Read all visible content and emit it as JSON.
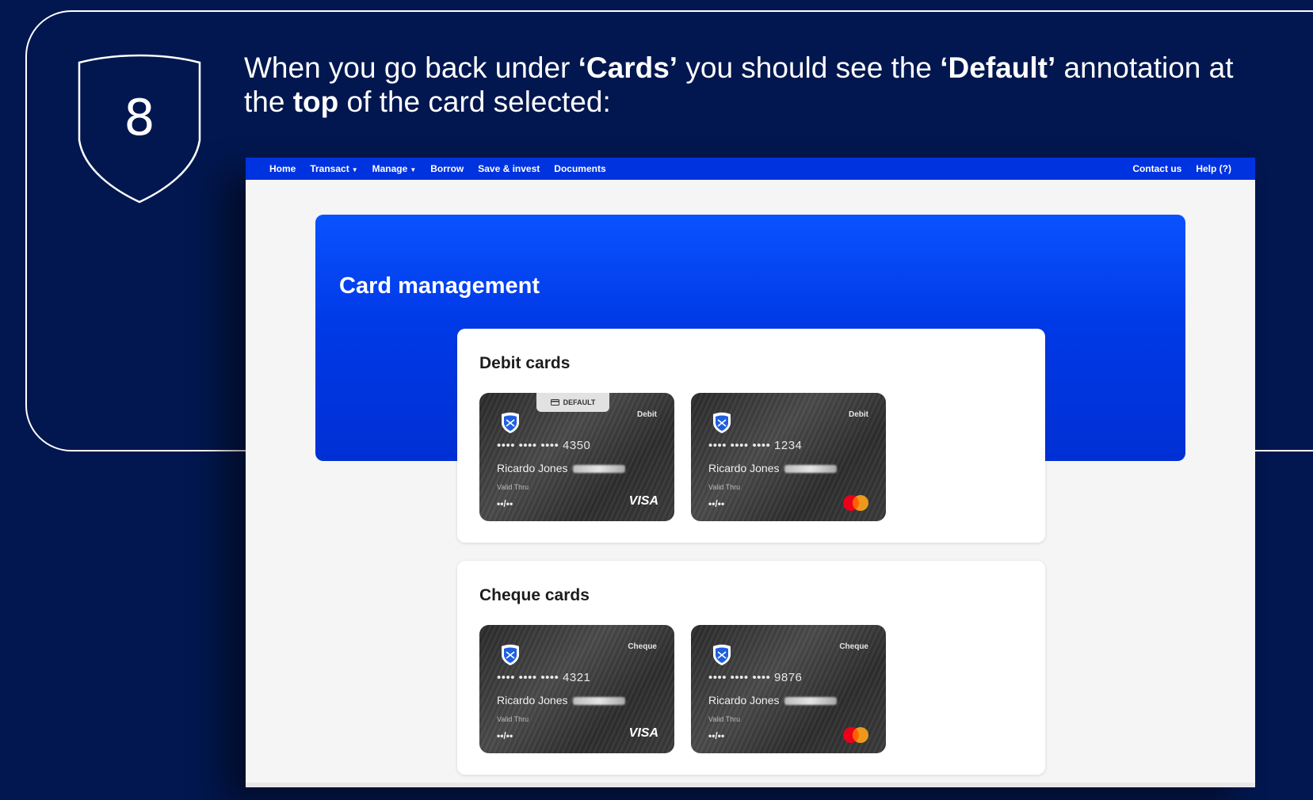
{
  "step": {
    "number": "8",
    "instruction": {
      "part1": "When you go back under ",
      "bold1": "‘Cards’",
      "part2": " you should see the ",
      "bold2": "‘Default’",
      "part3": " annotation at the ",
      "bold3": "top",
      "part4": " of the card selected:"
    }
  },
  "nav": {
    "left": [
      {
        "label": "Home",
        "dropdown": false
      },
      {
        "label": "Transact",
        "dropdown": true
      },
      {
        "label": "Manage",
        "dropdown": true
      },
      {
        "label": "Borrow",
        "dropdown": false
      },
      {
        "label": "Save & invest",
        "dropdown": false
      },
      {
        "label": "Documents",
        "dropdown": false
      }
    ],
    "right": [
      {
        "label": "Contact us"
      },
      {
        "label": "Help (?)"
      }
    ]
  },
  "page": {
    "title": "Card management"
  },
  "sections": {
    "debit": {
      "title": "Debit cards",
      "cards": [
        {
          "type": "Debit",
          "number": "•••• •••• •••• 4350",
          "holder": "Ricardo Jones",
          "valid_label": "Valid Thru",
          "valid": "••/••",
          "brand": "VISA",
          "default": true
        },
        {
          "type": "Debit",
          "number": "•••• •••• •••• 1234",
          "holder": "Ricardo Jones",
          "valid_label": "Valid Thru",
          "valid": "••/••",
          "brand": "mastercard",
          "default": false
        }
      ]
    },
    "cheque": {
      "title": "Cheque cards",
      "cards": [
        {
          "type": "Cheque",
          "number": "•••• •••• •••• 4321",
          "holder": "Ricardo Jones",
          "valid_label": "Valid Thru",
          "valid": "••/••",
          "brand": "VISA",
          "default": false
        },
        {
          "type": "Cheque",
          "number": "•••• •••• •••• 9876",
          "holder": "Ricardo Jones",
          "valid_label": "Valid Thru",
          "valid": "••/••",
          "brand": "mastercard",
          "default": false
        }
      ]
    }
  },
  "badge": {
    "label": "DEFAULT"
  },
  "colors": {
    "background": "#02174f",
    "nav": "#0033e0",
    "hero": "#0039e6",
    "mastercard_red": "#eb001b",
    "mastercard_orange": "#f79e1b"
  }
}
